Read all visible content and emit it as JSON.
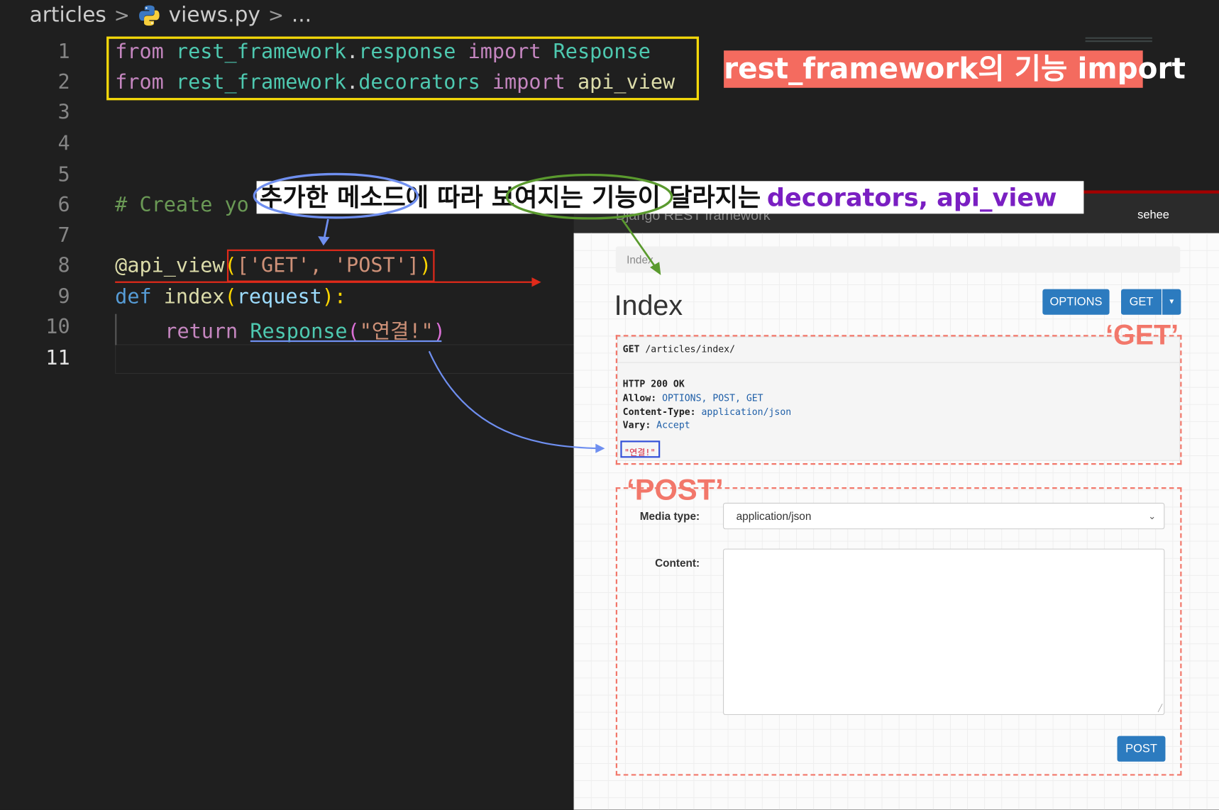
{
  "breadcrumb": {
    "folder": "articles",
    "file": "views.py",
    "more": "..."
  },
  "editor": {
    "line_numbers": [
      "1",
      "2",
      "3",
      "4",
      "5",
      "6",
      "7",
      "8",
      "9",
      "10",
      "11"
    ],
    "lines": {
      "l1": {
        "kw1": "from",
        "mod": "rest_framework",
        "dot": ".",
        "sub": "response",
        "kw2": "import",
        "name": "Response"
      },
      "l2": {
        "kw1": "from",
        "mod": "rest_framework",
        "dot": ".",
        "sub": "decorators",
        "kw2": "import",
        "name": "api_view"
      },
      "l6": "# Create yo",
      "l8": {
        "decorator": "@api_view",
        "open": "(",
        "list": "['GET', 'POST']",
        "close": ")"
      },
      "l9": {
        "def": "def",
        "name": "index",
        "open": "(",
        "param": "request",
        "close": "):"
      },
      "l10": {
        "kw": "return",
        "cls": "Response",
        "open": "(",
        "str": "\"연결!\"",
        "close": ")"
      }
    }
  },
  "annotations": {
    "import_label": "rest_framework의 기능 import",
    "banner_text": "추가한 메소드에 따라 보여지는 기능이 달라지는",
    "banner_highlight": "decorators, api_view",
    "get_label": "‘GET’",
    "post_label": "‘POST’"
  },
  "browser": {
    "brand": "Django REST framework",
    "user": "sehee",
    "breadcrumb": "Index",
    "title": "Index",
    "options_button": "OPTIONS",
    "get_button": "GET",
    "caret": "▾",
    "request": {
      "method": "GET",
      "path": "/articles/index/"
    },
    "response": {
      "status": "HTTP 200 OK",
      "allow_label": "Allow:",
      "allow_value": "OPTIONS, POST, GET",
      "ctype_label": "Content-Type:",
      "ctype_value": "application/json",
      "vary_label": "Vary:",
      "vary_value": "Accept",
      "body": "\"연결!\""
    },
    "form": {
      "media_type_label": "Media type:",
      "media_type_value": "application/json",
      "content_label": "Content:",
      "post_button": "POST"
    }
  },
  "colors": {
    "keyword": "#c586c0",
    "module": "#4ec9b0",
    "function": "#dcdcaa",
    "string": "#ce9178",
    "comment": "#6a9955",
    "accent_blue": "#2c7bbf",
    "annotation_red": "#f2776a",
    "highlight_yellow": "#f5d90a"
  }
}
